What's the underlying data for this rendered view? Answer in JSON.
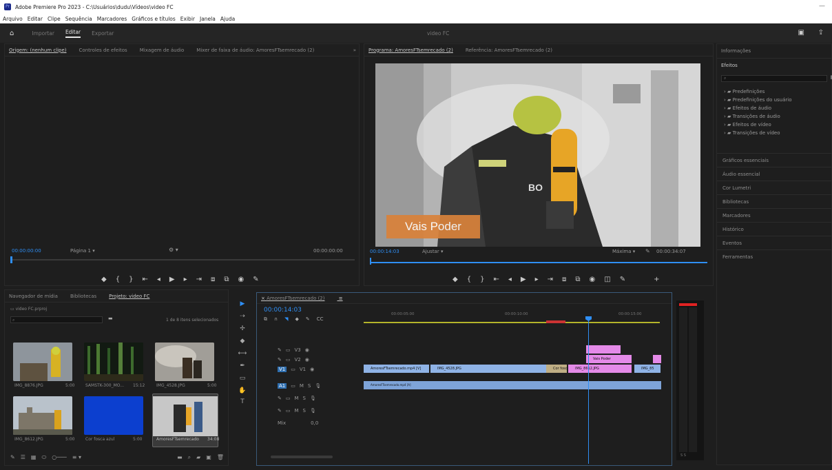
{
  "window": {
    "title": "Adobe Premiere Pro 2023 - C:\\Usuários\\dudu\\Vídeos\\video FC",
    "minimize": "—"
  },
  "menu": [
    "Arquivo",
    "Editar",
    "Clipe",
    "Sequência",
    "Marcadores",
    "Gráficos e títulos",
    "Exibir",
    "Janela",
    "Ajuda"
  ],
  "workspace": {
    "tabs": [
      "Importar",
      "Editar",
      "Exportar"
    ],
    "active": "Editar",
    "project_title": "video FC"
  },
  "source_monitor": {
    "tabs": [
      "Origem: (nenhum clipe)",
      "Controles de efeitos",
      "Mixagem de áudio",
      "Mixer de faixa de áudio: AmoresFTsemrecado (2)"
    ],
    "timecode_left": "00:00:00:00",
    "fit": "Página 1",
    "timecode_right": "00:00:00:00"
  },
  "program_monitor": {
    "tabs": [
      "Programa: AmoresFTsemrecado (2)",
      "Referência: AmoresFTsemrecado (2)"
    ],
    "caption": "Vais Poder",
    "timecode_left": "00:00:14:03",
    "fit": "Ajustar",
    "quality": "Máxima",
    "timecode_right": "00:00:34:07"
  },
  "right_panel": {
    "headers": [
      "Informações",
      "Efeitos"
    ],
    "tree": [
      "Predefinições",
      "Predefinições do usuário",
      "Efeitos de áudio",
      "Transições de áudio",
      "Efeitos de vídeo",
      "Transições de vídeo"
    ],
    "sections": [
      "Gráficos essenciais",
      "Áudio essencial",
      "Cor Lumetri",
      "Bibliotecas",
      "Marcadores",
      "Histórico",
      "Eventos",
      "Ferramentas"
    ]
  },
  "project_panel": {
    "tabs": [
      "Navegador de mídia",
      "Bibliotecas",
      "Projeto: video FC"
    ],
    "path": "video FC.prproj",
    "selection": "1 de 8 itens selecionados",
    "items": [
      {
        "name": "IMG_8876.JPG",
        "dur": "5:00"
      },
      {
        "name": "SAMSTK-300_MO...",
        "dur": "15:12"
      },
      {
        "name": "IMG_4528.JPG",
        "dur": "5:00"
      },
      {
        "name": "IMG_8612.JPG",
        "dur": "5:00"
      },
      {
        "name": "Cor fosca azul",
        "dur": "5:00"
      },
      {
        "name": "AmoresFTsemrecado",
        "dur": "34:08"
      }
    ]
  },
  "timeline": {
    "tab": "AmoresFTsemrecado (2)",
    "timecode": "00:00:14:03",
    "ruler": [
      "00:00:05:00",
      "00:00:10:00",
      "00:00:15:00"
    ],
    "clips_v1": [
      "AmoresFTsemrecado.mp4 [V]",
      "IMG_4528.JPG",
      "Cor fosca azul",
      "IMG_8612.JPG",
      "IMG_85"
    ],
    "clips_v2": [
      "Vais Poder"
    ],
    "audio_clip": "AmoresFTsemrecado.mp4 [A]"
  },
  "colors": {
    "accent": "#2f8ff5",
    "clip_video": "#8fb3e6",
    "clip_graphic": "#e48ae8",
    "clip_image": "#e2b24a"
  }
}
